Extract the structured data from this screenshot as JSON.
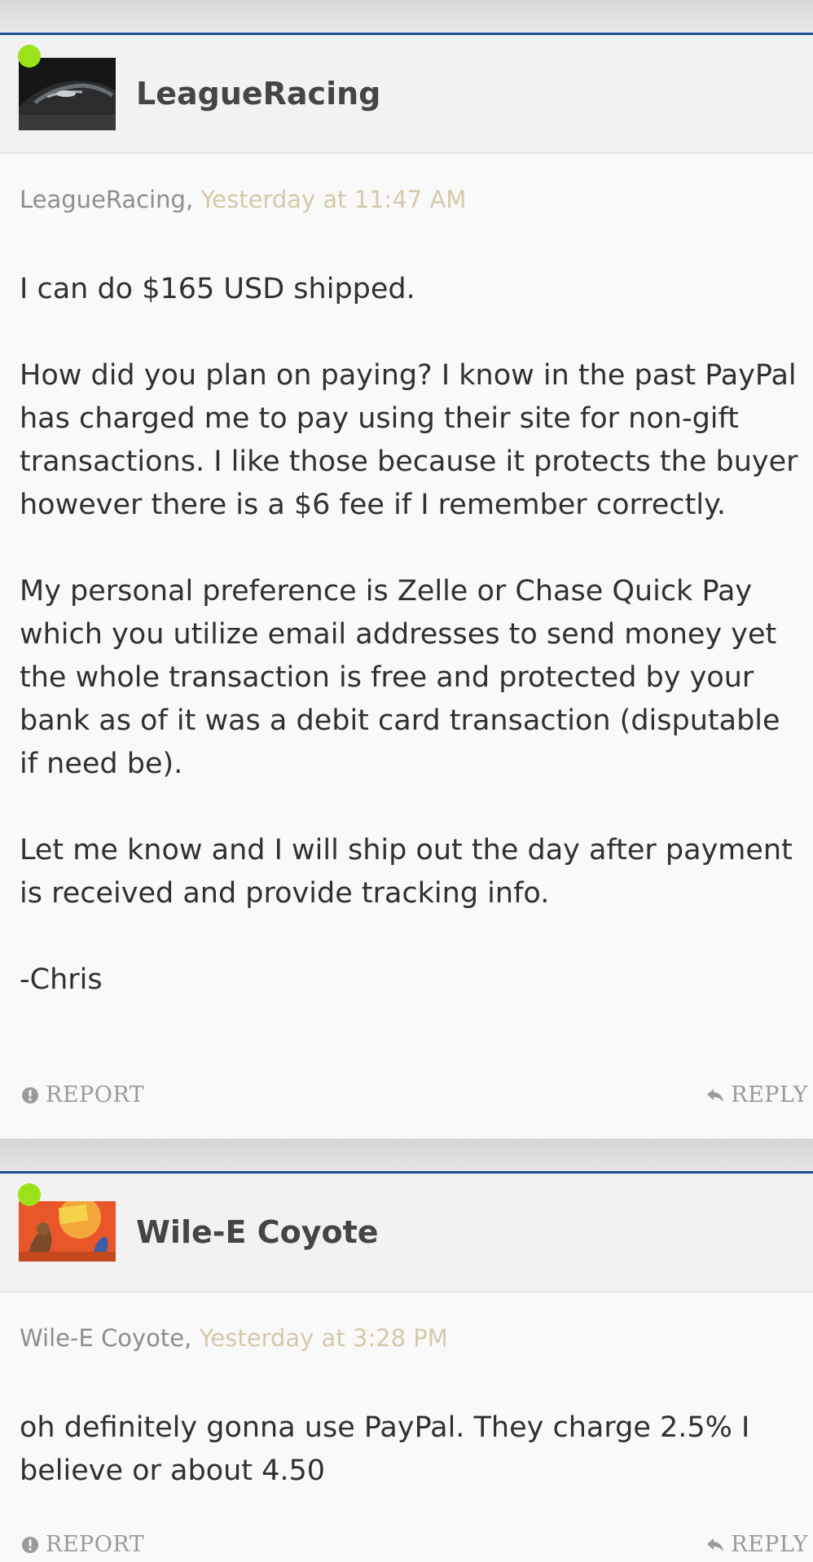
{
  "posts": [
    {
      "username": "LeagueRacing",
      "meta_author": "LeagueRacing,",
      "meta_time": "Yesterday at 11:47 AM",
      "paragraphs": [
        "I can do $165 USD shipped.",
        "How did you plan on paying? I know in the past PayPal has charged me to pay using their site for non-gift transactions. I like those because it protects the buyer however there is a $6 fee if I remember correctly.",
        "My personal preference is Zelle or Chase Quick Pay which you utilize email addresses to send money yet the whole transaction is free and protected by your bank as of it was a debit card transaction (disputable if need be).",
        "Let me know and I will ship out the day after payment is received and provide tracking info.",
        "-Chris"
      ],
      "report_label": "REPORT",
      "reply_label": "REPLY"
    },
    {
      "username": "Wile-E Coyote",
      "meta_author": "Wile-E Coyote,",
      "meta_time": "Yesterday at 3:28 PM",
      "paragraphs": [
        "oh definitely gonna use PayPal. They charge 2.5% I believe or about 4.50"
      ],
      "report_label": "REPORT",
      "reply_label": "REPLY"
    }
  ],
  "colors": {
    "accent_border": "#1d4f91",
    "online": "#9be318",
    "timestamp": "#d6c9a9"
  }
}
